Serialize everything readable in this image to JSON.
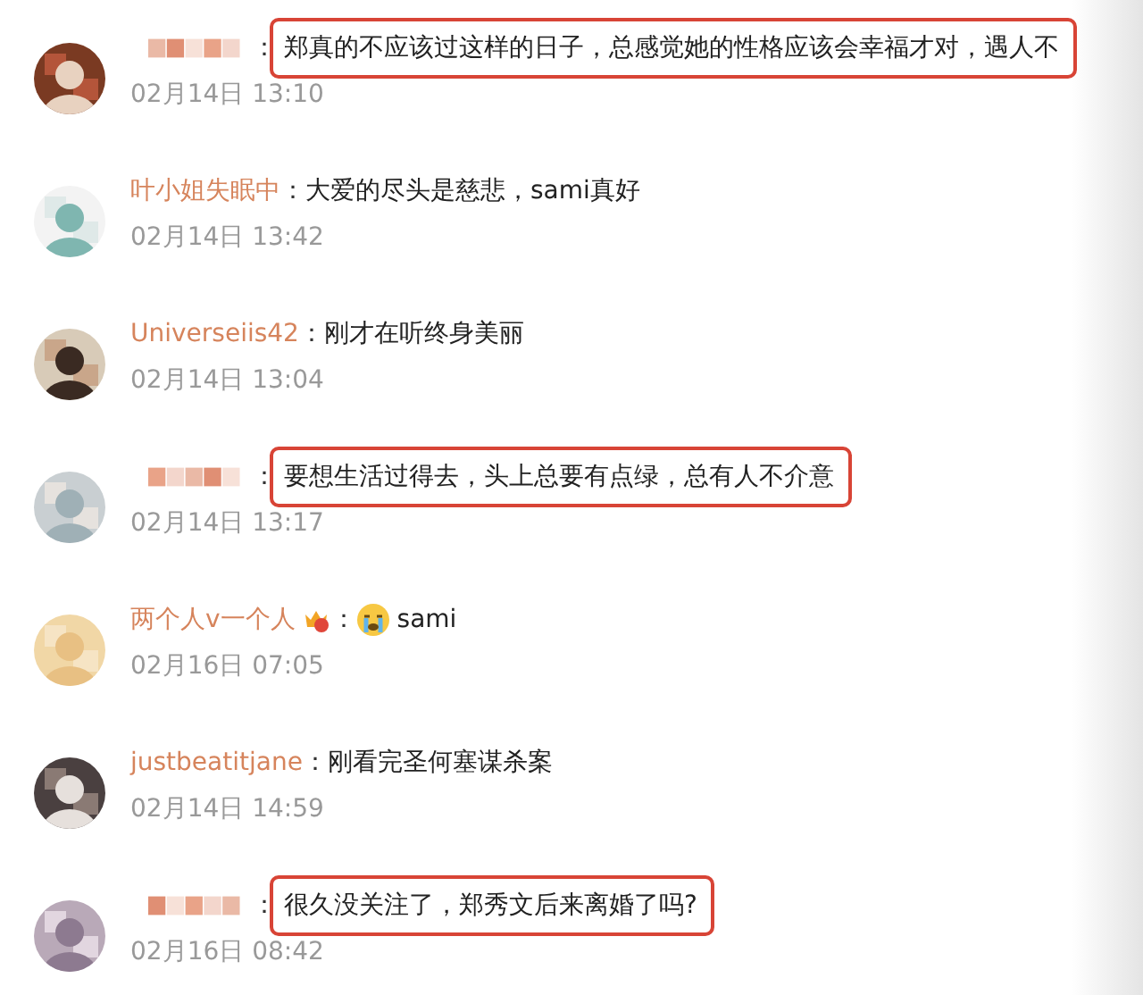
{
  "comments": [
    {
      "author": {
        "kind": "pixelated"
      },
      "separator": "：",
      "text": "郑真的不应该过这样的日子，总感觉她的性格应该会幸福才对，遇人不",
      "time": "02月14日 13:10",
      "highlighted": true
    },
    {
      "author": {
        "kind": "name",
        "name": "叶小姐失眠中"
      },
      "separator": "：",
      "text": "大爱的尽头是慈悲，sami真好",
      "time": "02月14日 13:42",
      "highlighted": false
    },
    {
      "author": {
        "kind": "name",
        "name": "Universeiis42"
      },
      "separator": "：",
      "text": "刚才在听终身美丽",
      "time": "02月14日 13:04",
      "highlighted": false
    },
    {
      "author": {
        "kind": "pixelated"
      },
      "separator": "：",
      "text": "要想生活过得去，头上总要有点绿，总有人不介意",
      "time": "02月14日 13:17",
      "highlighted": true
    },
    {
      "author": {
        "kind": "name",
        "name": "两个人v一个人",
        "badge": true
      },
      "separator": "：",
      "emoji": true,
      "text": "sami",
      "time": "02月16日 07:05",
      "highlighted": false
    },
    {
      "author": {
        "kind": "name",
        "name": "justbeatitjane"
      },
      "separator": "：",
      "text": "刚看完圣何塞谋杀案",
      "time": "02月14日 14:59",
      "highlighted": false
    },
    {
      "author": {
        "kind": "pixelated"
      },
      "separator": "：",
      "text": "很久没关注了，郑秀文后来离婚了吗?",
      "time": "02月16日 08:42",
      "highlighted": true
    }
  ]
}
